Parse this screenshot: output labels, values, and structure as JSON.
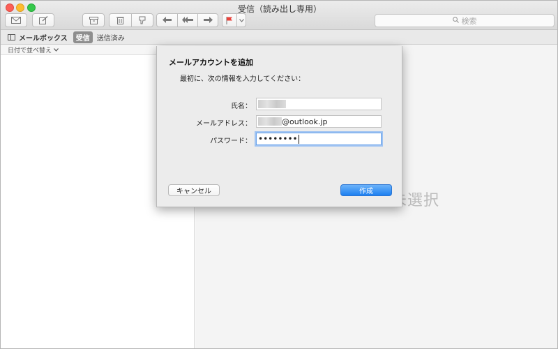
{
  "window": {
    "title": "受信（読み出し専用）"
  },
  "toolbar": {
    "icons": [
      "envelope-icon",
      "compose-icon",
      "archive-icon",
      "trash-icon",
      "junk-icon",
      "reply-icon",
      "reply-all-icon",
      "forward-icon",
      "flag-icon",
      "chevron-down-icon"
    ],
    "search_placeholder": "検索"
  },
  "favorites": {
    "mailboxes_label": "メールボックス",
    "inbox_label": "受信",
    "sent_label": "送信済み"
  },
  "sort": {
    "label": "日付で並べ替え"
  },
  "content": {
    "empty_text": "未選択"
  },
  "dialog": {
    "title": "メールアカウントを追加",
    "subtitle": "最初に、次の情報を入力してください：",
    "fields": [
      {
        "label": "氏名：",
        "value": ""
      },
      {
        "label": "メールアドレス：",
        "value": "@outlook.jp"
      },
      {
        "label": "パスワード：",
        "value": "••••••••"
      }
    ],
    "cancel_label": "キャンセル",
    "create_label": "作成"
  },
  "colors": {
    "accent": "#1d7ff0",
    "flag": "#e8423b",
    "focus_ring": "#9fc3f2"
  }
}
